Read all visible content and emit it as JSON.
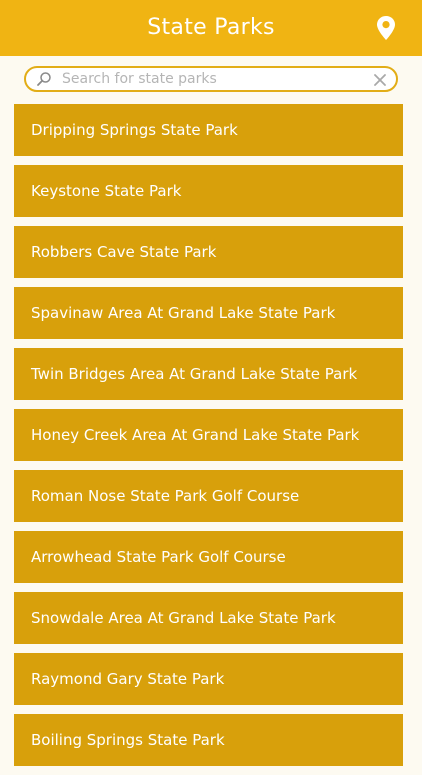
{
  "header": {
    "title": "State Parks",
    "icon": "map-pin-icon",
    "background": "#f0b413"
  },
  "search": {
    "placeholder": "Search for state parks",
    "value": "",
    "icon": "search-icon",
    "clear_icon": "clear-icon"
  },
  "parks": [
    {
      "label": "Dripping Springs State Park"
    },
    {
      "label": "Keystone State Park"
    },
    {
      "label": "Robbers Cave State Park"
    },
    {
      "label": "Spavinaw Area At Grand Lake State Park"
    },
    {
      "label": "Twin Bridges Area At Grand Lake State Park"
    },
    {
      "label": "Honey Creek Area At Grand Lake State Park"
    },
    {
      "label": "Roman Nose State Park Golf Course"
    },
    {
      "label": "Arrowhead State Park Golf Course"
    },
    {
      "label": "Snowdale Area At Grand Lake State Park"
    },
    {
      "label": "Raymond Gary State Park"
    },
    {
      "label": "Boiling Springs State Park"
    }
  ],
  "colors": {
    "accent": "#f0b413",
    "item_background": "#d8a00b",
    "page_background": "#fdfaf1"
  }
}
